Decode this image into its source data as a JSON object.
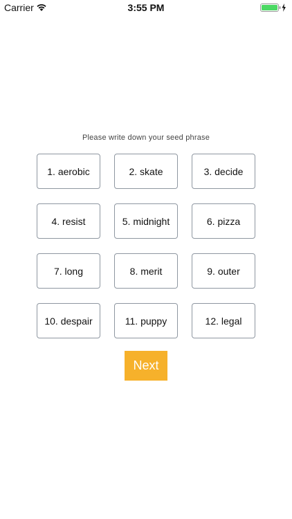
{
  "status_bar": {
    "carrier": "Carrier",
    "time": "3:55 PM",
    "battery_color": "#4cd964"
  },
  "instruction": "Please write down your seed phrase",
  "words": [
    "1. aerobic",
    "2. skate",
    "3. decide",
    "4. resist",
    "5. midnight",
    "6. pizza",
    "7. long",
    "8. merit",
    "9. outer",
    "10. despair",
    "11. puppy",
    "12. legal"
  ],
  "next_button": {
    "label": "Next",
    "color": "#f6b12b"
  }
}
